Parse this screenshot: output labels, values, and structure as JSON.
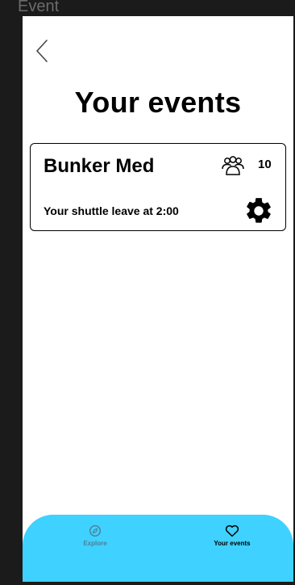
{
  "window": {
    "title": "Event"
  },
  "header": {
    "back_icon": "chevron-left-icon",
    "title": "Your events"
  },
  "events": [
    {
      "name": "Bunker Med",
      "attendee_icon": "people-icon",
      "attendee_count": "10",
      "shuttle_text": "Your shuttle leave at 2:00",
      "settings_icon": "gear-icon"
    }
  ],
  "tab_bar": {
    "background": "#3fd1ff",
    "tabs": [
      {
        "label": "Explore",
        "icon": "compass-icon",
        "active": false
      },
      {
        "label": "Your events",
        "icon": "heart-icon",
        "active": true
      }
    ]
  }
}
